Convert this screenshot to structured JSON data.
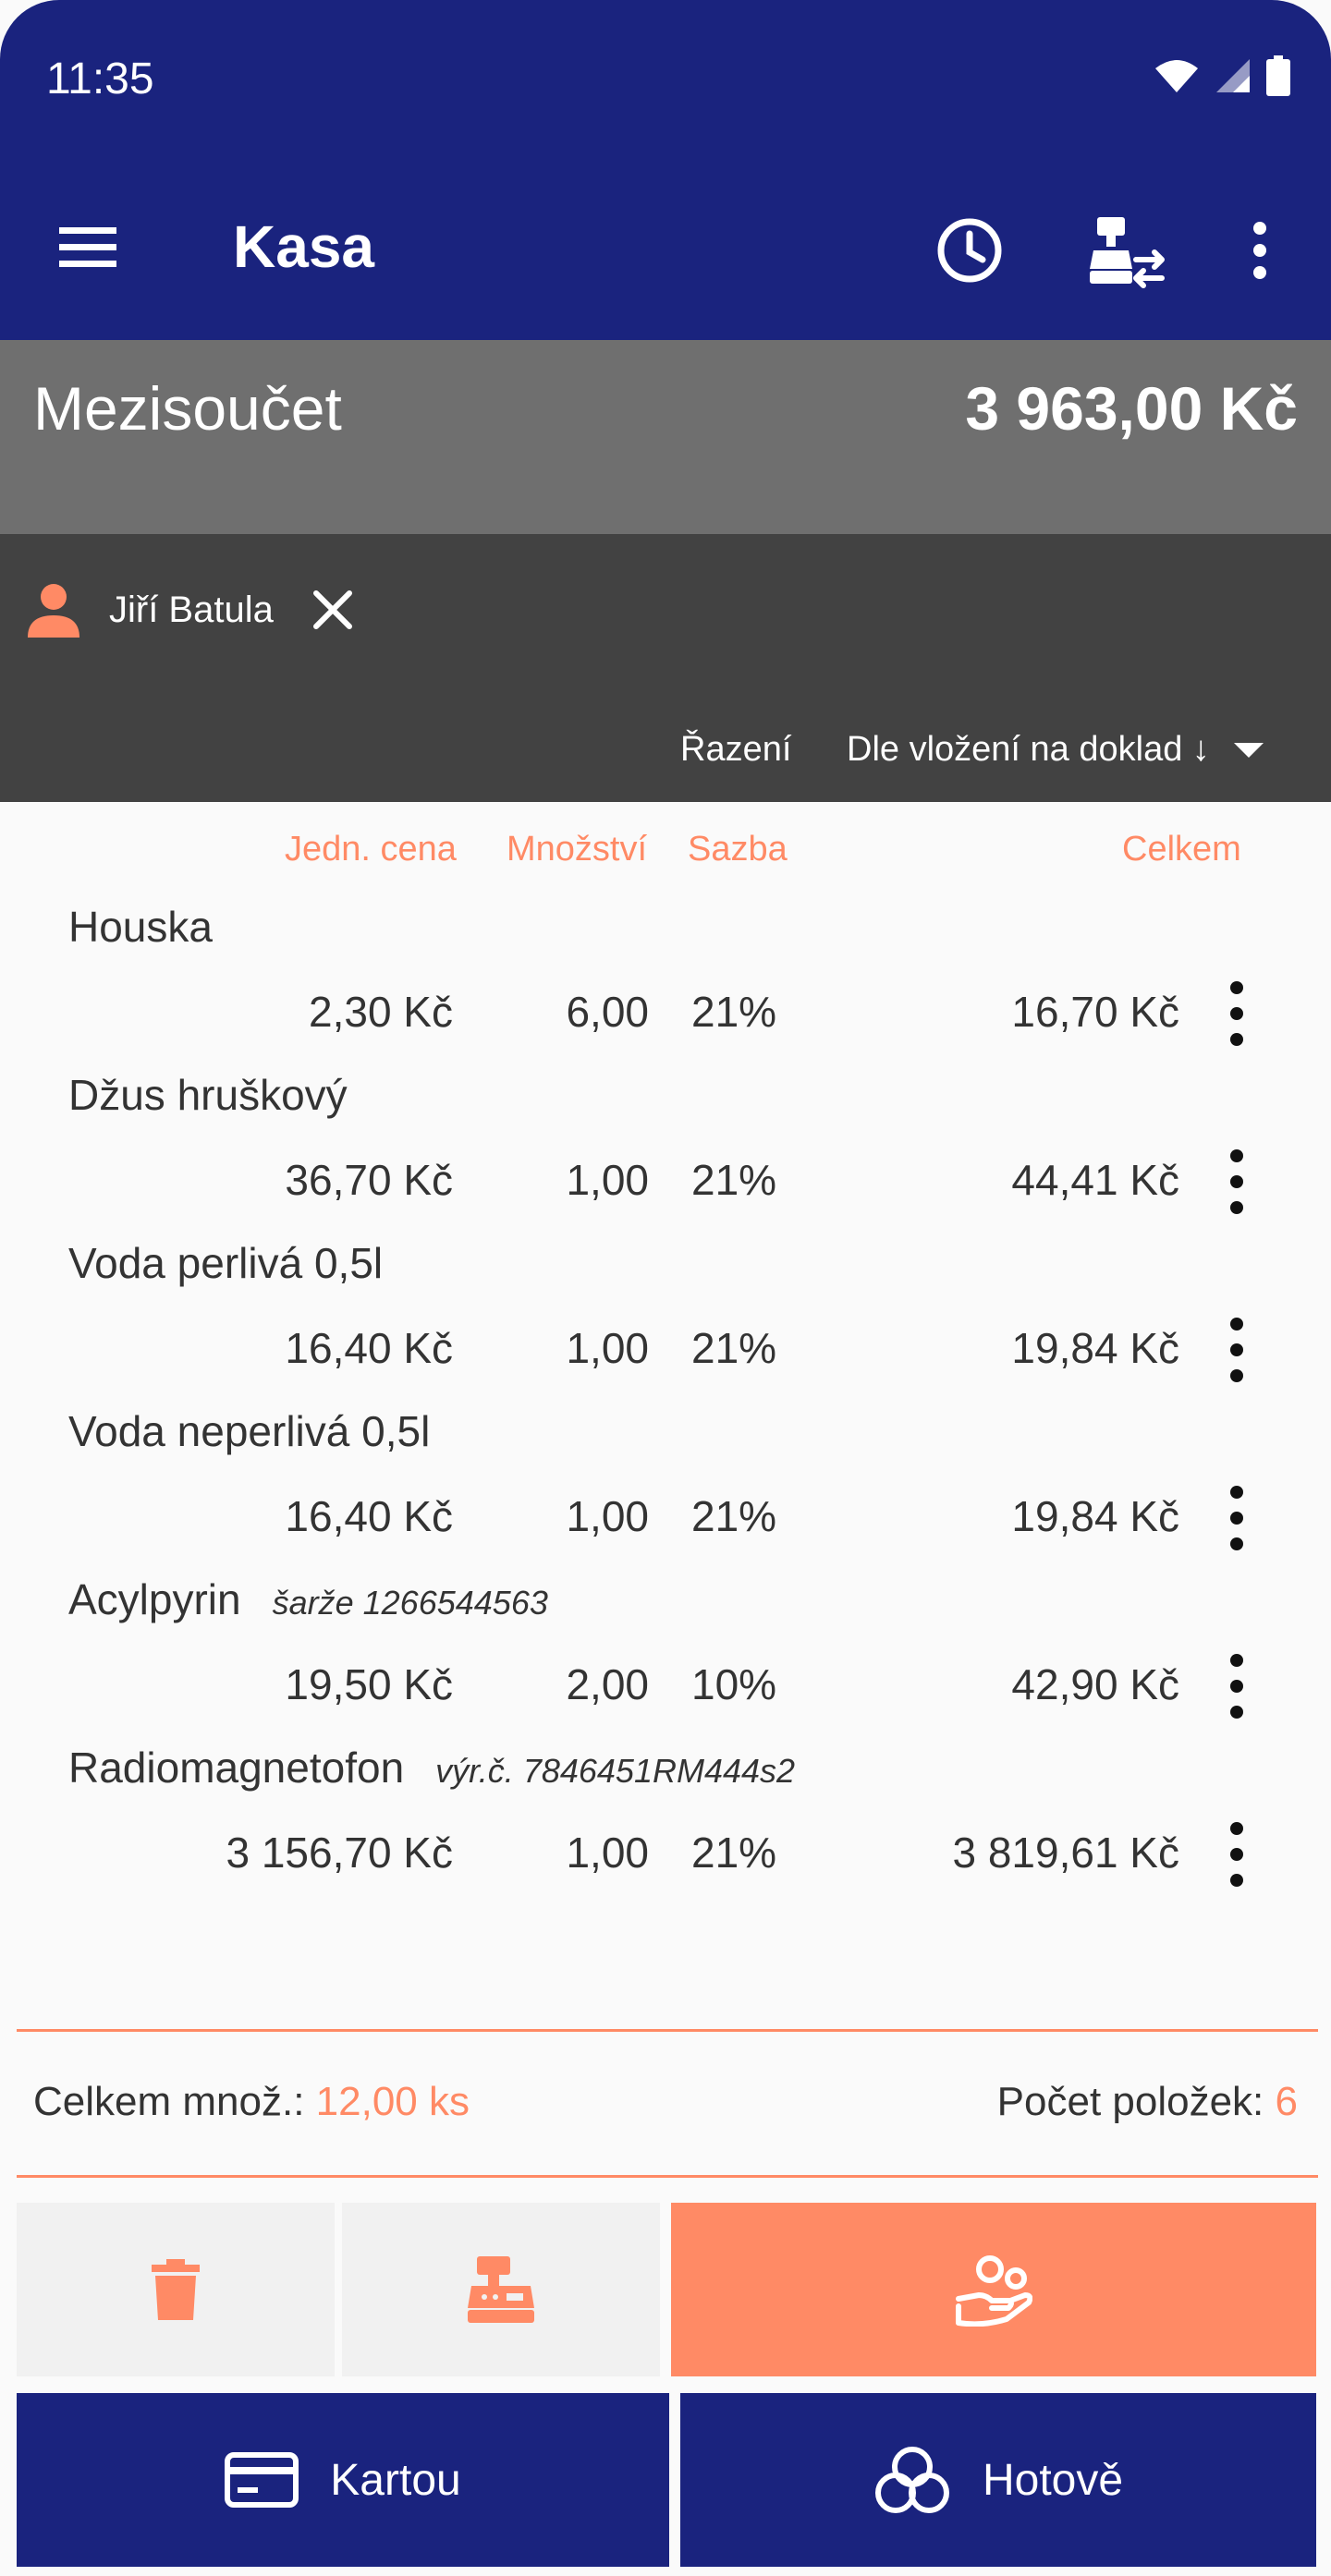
{
  "status_bar": {
    "time": "11:35"
  },
  "app_bar": {
    "title": "Kasa"
  },
  "subtotal": {
    "label": "Mezisoučet",
    "value": "3 963,00 Kč"
  },
  "customer": {
    "name": "Jiří Batula"
  },
  "sort": {
    "label": "Řazení",
    "selected": "Dle vložení na doklad ↓"
  },
  "columns": {
    "unit_price": "Jedn. cena",
    "quantity": "Množství",
    "vat": "Sazba",
    "total": "Celkem"
  },
  "items": [
    {
      "name": "Houska",
      "note": "",
      "unit_price": "2,30 Kč",
      "quantity": "6,00",
      "vat": "21%",
      "total": "16,70 Kč"
    },
    {
      "name": "Džus hruškový",
      "note": "",
      "unit_price": "36,70 Kč",
      "quantity": "1,00",
      "vat": "21%",
      "total": "44,41 Kč"
    },
    {
      "name": "Voda perlivá 0,5l",
      "note": "",
      "unit_price": "16,40 Kč",
      "quantity": "1,00",
      "vat": "21%",
      "total": "19,84 Kč"
    },
    {
      "name": "Voda neperlivá 0,5l",
      "note": "",
      "unit_price": "16,40 Kč",
      "quantity": "1,00",
      "vat": "21%",
      "total": "19,84 Kč"
    },
    {
      "name": "Acylpyrin",
      "note": "šarže 1266544563",
      "unit_price": "19,50 Kč",
      "quantity": "2,00",
      "vat": "10%",
      "total": "42,90 Kč"
    },
    {
      "name": "Radiomagnetofon",
      "note": "výr.č. 7846451RM444s2",
      "unit_price": "3 156,70 Kč",
      "quantity": "1,00",
      "vat": "21%",
      "total": "3 819,61 Kč"
    }
  ],
  "summary": {
    "total_qty_label": "Celkem množ.:",
    "total_qty_value": "12,00 ks",
    "item_count_label": "Počet položek:",
    "item_count_value": "6"
  },
  "payment": {
    "card_label": "Kartou",
    "cash_label": "Hotově"
  },
  "colors": {
    "primary": "#1a237e",
    "accent": "#ff8a65",
    "subtotal_bg": "#6f6f6f",
    "customer_bg": "#424242"
  },
  "icons": {
    "menu": "menu-icon",
    "history": "clock-icon",
    "transfer": "register-transfer-icon",
    "more": "more-vertical-icon",
    "customer": "person-icon",
    "remove_customer": "close-icon",
    "delete": "trash-icon",
    "register": "cash-register-icon",
    "customer_action": "customer-hand-icon",
    "card": "credit-card-icon",
    "cash": "coins-icon"
  }
}
